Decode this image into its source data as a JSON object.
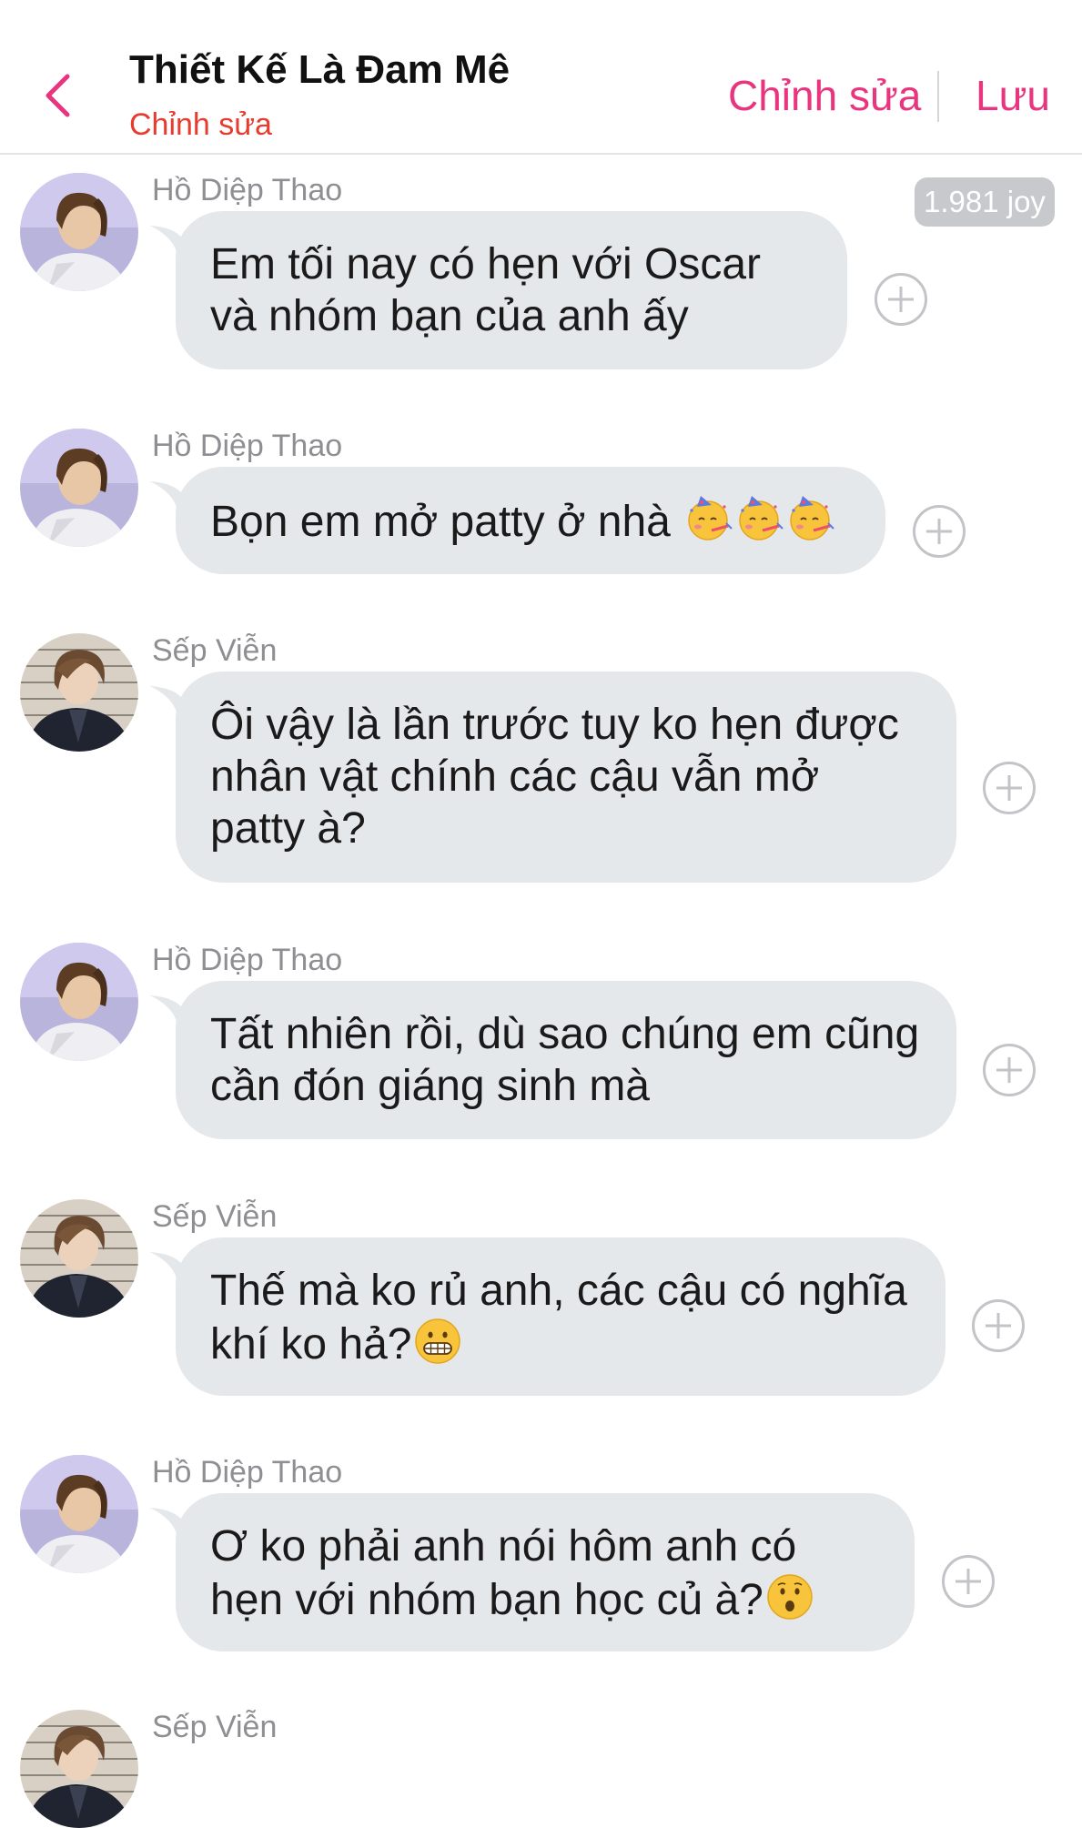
{
  "header": {
    "title": "Thiết Kế Là Đam Mê",
    "subtitle": "Chỉnh sửa",
    "edit_label": "Chỉnh sửa",
    "save_label": "Lưu",
    "accent_color": "#e8357e",
    "subtitle_color": "#e63b2e"
  },
  "joy_badge": "1.981 joy",
  "messages": [
    {
      "sender": "Hồ Diệp Thao",
      "text": "Em tối nay có hẹn với Oscar và nhóm bạn của anh ấy",
      "emoji": []
    },
    {
      "sender": "Hồ Diệp Thao",
      "text": "Bọn em mở patty ở nhà ",
      "emoji": [
        "partying-face",
        "partying-face",
        "partying-face"
      ]
    },
    {
      "sender": "Sếp Viễn",
      "text": "Ôi vậy là lần trước tuy ko hẹn được nhân vật chính các cậu vẫn mở patty à?",
      "emoji": []
    },
    {
      "sender": "Hồ Diệp Thao",
      "text": "Tất nhiên rồi, dù sao chúng em cũng cần đón giáng sinh mà",
      "emoji": []
    },
    {
      "sender": "Sếp Viễn",
      "text": "Thế mà ko rủ anh, các cậu có nghĩa khí ko hả?",
      "emoji": [
        "grimacing-face"
      ]
    },
    {
      "sender": "Hồ Diệp Thao",
      "text": "Ơ ko phải anh nói hôm anh có hẹn với nhóm bạn học củ à?",
      "emoji": [
        "hushed-face"
      ]
    },
    {
      "sender": "Sếp Viễn",
      "text": "",
      "emoji": []
    }
  ],
  "colors": {
    "bubble": "#e5e8eb",
    "sender": "#8e8e93",
    "plus_icon": "#c3c3c8"
  }
}
